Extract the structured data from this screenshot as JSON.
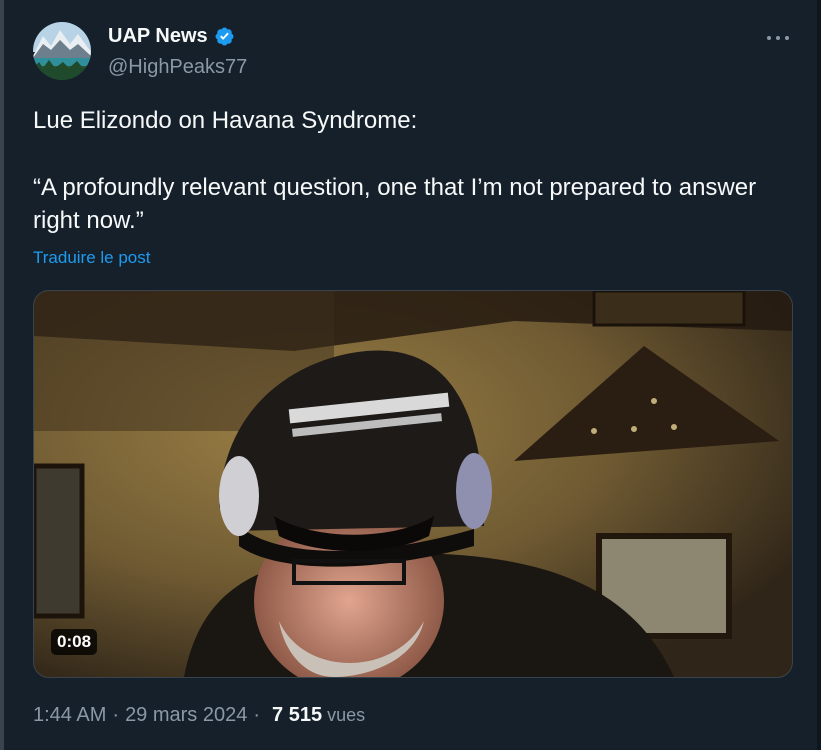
{
  "author": {
    "display_name": "UAP News",
    "handle": "@HighPeaks77",
    "verified": true,
    "verified_color": "#1d9bf0",
    "avatar_icon": "mountain-lake-avatar"
  },
  "more_icon": "more-horizontal-icon",
  "post": {
    "line1": "Lue Elizondo on Havana Syndrome:",
    "line2": "“A profoundly relevant question, one that I’m not prepared to answer right now.”",
    "translate_label": "Traduire le post"
  },
  "media": {
    "type": "video",
    "duration": "0:08"
  },
  "meta": {
    "time": "1:44 AM",
    "date": "29 mars 2024",
    "separator": "·",
    "views_count": "7 515",
    "views_label": "vues"
  },
  "colors": {
    "background": "#15202b",
    "text": "#f7f9f9",
    "muted": "#8b98a5",
    "link": "#1d9bf0"
  }
}
